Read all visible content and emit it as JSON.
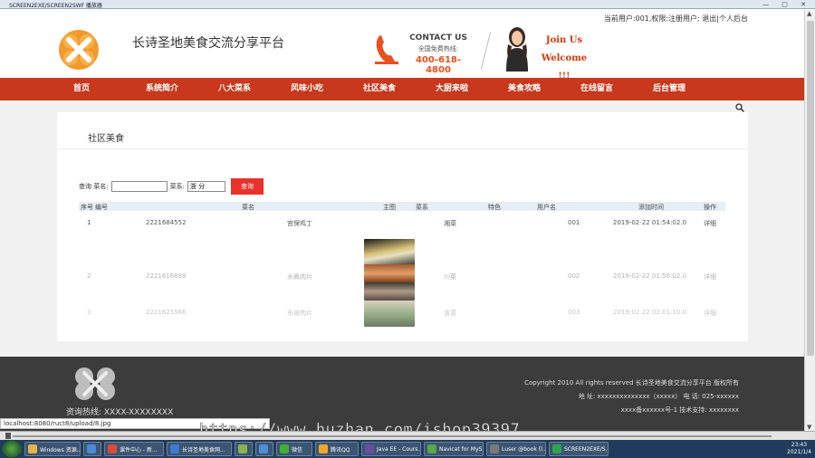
{
  "window": {
    "title": "SCREEN2EXE/SCREEN2SWF 播放器"
  },
  "header": {
    "user_info": "当前用户:001,权限:注册用户; 退出|个人后台",
    "site_title": "长诗圣地美食交流分享平台",
    "contact_us": "CONTACT US",
    "hotline_label": "全国免费热线:",
    "hotline_number": "400-618-4800",
    "join_us": "Join Us",
    "welcome": "Welcome !!!"
  },
  "nav": [
    "首页",
    "系统简介",
    "八大菜系",
    "风味小吃",
    "社区美食",
    "大厨来啦",
    "美食攻略",
    "在线留言",
    "后台管理"
  ],
  "panel": {
    "title": "社区美食",
    "query_label1": "查询 菜名:",
    "query_label2": "菜系:",
    "cuisine_value": "浙 分",
    "query_button": "查询"
  },
  "table": {
    "headers": [
      "序号",
      "编号",
      "菜名",
      "主图",
      "菜系",
      "特色",
      "用户名",
      "添加时间",
      "操作"
    ],
    "rows": [
      {
        "idx": "1",
        "code": "2221684552",
        "name": "宫保鸡丁",
        "cuisine": "湘菜",
        "feature": "",
        "user": "001",
        "time": "2019-02-22 01:54:02.0",
        "op": "详细"
      },
      {
        "idx": "2",
        "code": "2221616888",
        "name": "水煮肉片",
        "cuisine": "川菜",
        "feature": "",
        "user": "002",
        "time": "2019-02-22 01:56:02.0",
        "op": "详细"
      },
      {
        "idx": "3",
        "code": "2221625566",
        "name": "东坡肉片",
        "cuisine": "浙菜",
        "feature": "",
        "user": "003",
        "time": "2019-02-22 02:01:10.0",
        "op": "详细"
      }
    ]
  },
  "footer": {
    "phone": "资询热线: XXXX-XXXXXXXX",
    "copyright": "Copyright 2010 All rights reserved 长诗圣地美食交流分享平台 版权所有",
    "address": "地 址: xxxxxxxxxxxxxx（xxxxx） 电 话: 025-xxxxxx",
    "icp": "xxxx备xxxxxx号-1 技术支持: xxxxxxxx"
  },
  "status_url": "localhost:8080/ruct8/upload/8.jpg",
  "watermark": "https://www.huzhan.com/ishop39397",
  "taskbar": {
    "items": [
      {
        "label": "Windows 资源...",
        "icon_color": "#e6b34a"
      },
      {
        "label": "",
        "icon_color": "#4a8ad8"
      },
      {
        "label": "课件中心 - 新...",
        "icon_color": "#d94b3a"
      },
      {
        "label": "长诗圣地美食网...",
        "icon_color": "#3b7bd4"
      },
      {
        "label": "",
        "icon_color": "#8bb24d"
      },
      {
        "label": "",
        "icon_color": "#4c91d8"
      },
      {
        "label": "微信",
        "icon_color": "#41b035"
      },
      {
        "label": "腾讯QQ",
        "icon_color": "#f2a72b"
      },
      {
        "label": "Java EE - Cours...",
        "icon_color": "#6b4ca0"
      },
      {
        "label": "Navicat for MyS...",
        "icon_color": "#57a847"
      },
      {
        "label": "Luser @book (l...",
        "icon_color": "#7a7a7a"
      },
      {
        "label": "SCREEN2EXE/S...",
        "icon_color": "#2da44e"
      }
    ],
    "time": "23:43",
    "date": "2021/1/4"
  },
  "colors": {
    "nav_bg": "#c8381c",
    "accent_orange": "#e8501f",
    "query_button": "#e8322b",
    "footer_bg": "#3c3c3c"
  }
}
